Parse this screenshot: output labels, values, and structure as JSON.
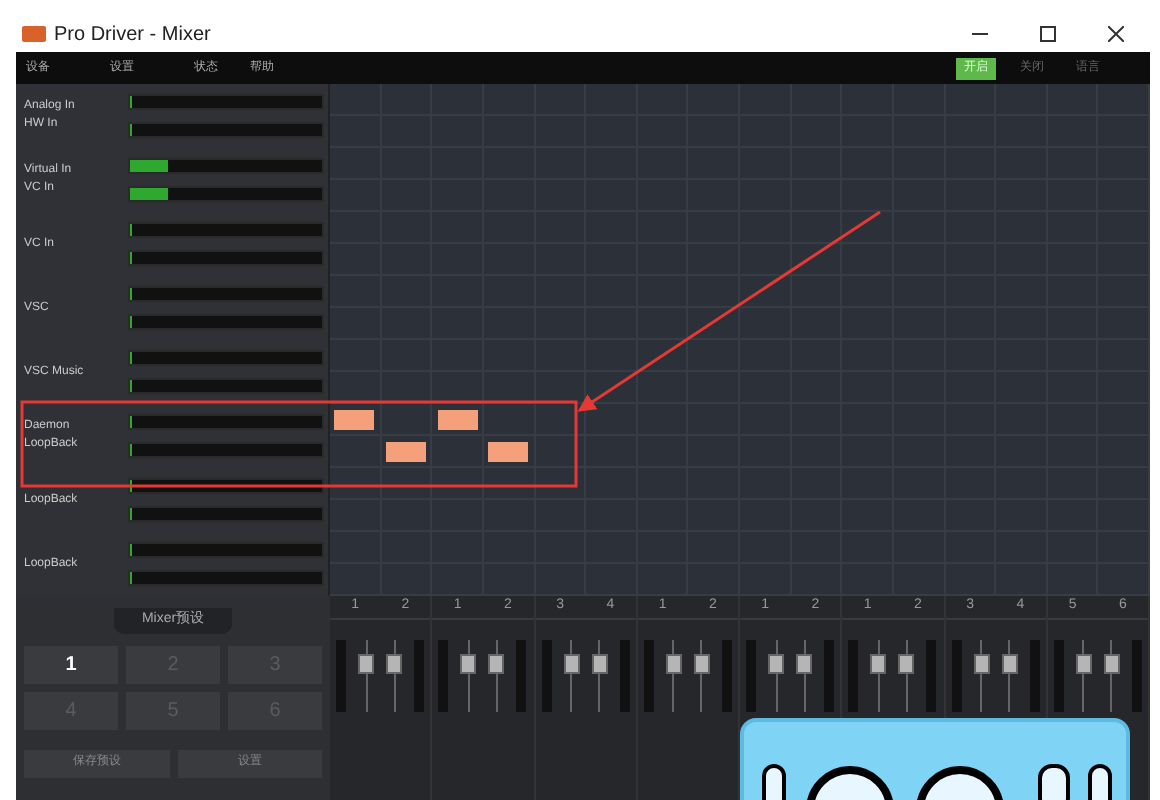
{
  "window": {
    "title": "Pro Driver - Mixer"
  },
  "menu": [
    "设备",
    "设置",
    "状态",
    "帮助"
  ],
  "toolbar": [
    {
      "label": "开启",
      "selected": true
    },
    {
      "label": "关闭",
      "selected": false
    },
    {
      "label": "语言",
      "selected": false
    }
  ],
  "channels": [
    {
      "label": [
        "Analog In",
        "HW In"
      ],
      "meters": [
        {
          "level": 0
        },
        {
          "level": 0
        }
      ]
    },
    {
      "label": [
        "Virtual In",
        "VC In"
      ],
      "meters": [
        {
          "level": 0.2
        },
        {
          "level": 0.2
        }
      ]
    },
    {
      "label": [
        "VC In"
      ],
      "meters": [
        {
          "level": 0
        },
        {
          "level": 0
        }
      ]
    },
    {
      "label": [
        "VSC"
      ],
      "meters": [
        {
          "level": 0
        },
        {
          "level": 0
        }
      ]
    },
    {
      "label": [
        "VSC Music"
      ],
      "meters": [
        {
          "level": 0
        },
        {
          "level": 0
        }
      ]
    },
    {
      "label": [
        "Daemon",
        "LoopBack"
      ],
      "meters": [
        {
          "level": 0
        },
        {
          "level": 0
        }
      ]
    },
    {
      "label": [
        "LoopBack"
      ],
      "meters": [
        {
          "level": 0
        },
        {
          "level": 0
        }
      ]
    },
    {
      "label": [
        "LoopBack"
      ],
      "meters": [
        {
          "level": 0
        },
        {
          "level": 0
        }
      ]
    }
  ],
  "grid": {
    "rows": [
      [
        false,
        false,
        false,
        false,
        false,
        false,
        false,
        false,
        false,
        false,
        false,
        false,
        false,
        false,
        false,
        false
      ],
      [
        false,
        false,
        false,
        false,
        false,
        false,
        false,
        false,
        false,
        false,
        false,
        false,
        false,
        false,
        false,
        false
      ],
      [
        false,
        false,
        false,
        false,
        false,
        false,
        false,
        false,
        false,
        false,
        false,
        false,
        false,
        false,
        false,
        false
      ],
      [
        false,
        false,
        false,
        false,
        false,
        false,
        false,
        false,
        false,
        false,
        false,
        false,
        false,
        false,
        false,
        false
      ],
      [
        false,
        false,
        false,
        false,
        false,
        false,
        false,
        false,
        false,
        false,
        false,
        false,
        false,
        false,
        false,
        false
      ],
      [
        false,
        false,
        false,
        false,
        false,
        false,
        false,
        false,
        false,
        false,
        false,
        false,
        false,
        false,
        false,
        false
      ],
      [
        false,
        false,
        false,
        false,
        false,
        false,
        false,
        false,
        false,
        false,
        false,
        false,
        false,
        false,
        false,
        false
      ],
      [
        false,
        false,
        false,
        false,
        false,
        false,
        false,
        false,
        false,
        false,
        false,
        false,
        false,
        false,
        false,
        false
      ],
      [
        false,
        false,
        false,
        false,
        false,
        false,
        false,
        false,
        false,
        false,
        false,
        false,
        false,
        false,
        false,
        false
      ],
      [
        false,
        false,
        false,
        false,
        false,
        false,
        false,
        false,
        false,
        false,
        false,
        false,
        false,
        false,
        false,
        false
      ],
      [
        true,
        false,
        true,
        false,
        false,
        false,
        false,
        false,
        false,
        false,
        false,
        false,
        false,
        false,
        false,
        false
      ],
      [
        false,
        true,
        false,
        true,
        false,
        false,
        false,
        false,
        false,
        false,
        false,
        false,
        false,
        false,
        false,
        false
      ],
      [
        false,
        false,
        false,
        false,
        false,
        false,
        false,
        false,
        false,
        false,
        false,
        false,
        false,
        false,
        false,
        false
      ],
      [
        false,
        false,
        false,
        false,
        false,
        false,
        false,
        false,
        false,
        false,
        false,
        false,
        false,
        false,
        false,
        false
      ],
      [
        false,
        false,
        false,
        false,
        false,
        false,
        false,
        false,
        false,
        false,
        false,
        false,
        false,
        false,
        false,
        false
      ],
      [
        false,
        false,
        false,
        false,
        false,
        false,
        false,
        false,
        false,
        false,
        false,
        false,
        false,
        false,
        false,
        false
      ]
    ]
  },
  "presets": {
    "title": "Mixer预设",
    "buttons": [
      {
        "label": "1",
        "selected": true
      },
      {
        "label": "2",
        "selected": false
      },
      {
        "label": "3",
        "selected": false
      },
      {
        "label": "4",
        "selected": false
      },
      {
        "label": "5",
        "selected": false
      },
      {
        "label": "6",
        "selected": false
      }
    ],
    "actions": [
      "保存预设",
      "设置"
    ]
  },
  "strips": [
    {
      "ports": [
        "1",
        "2"
      ],
      "faders": [
        {
          "level": 0.75
        },
        {
          "level": 0.75
        }
      ]
    },
    {
      "ports": [
        "1",
        "2"
      ],
      "faders": [
        {
          "level": 0.75
        },
        {
          "level": 0.75
        }
      ]
    },
    {
      "ports": [
        "3",
        "4"
      ],
      "faders": [
        {
          "level": 0.75
        },
        {
          "level": 0.75
        }
      ]
    },
    {
      "ports": [
        "1",
        "2"
      ],
      "faders": [
        {
          "level": 0.75
        },
        {
          "level": 0.75
        }
      ]
    },
    {
      "ports": [
        "1",
        "2"
      ],
      "faders": [
        {
          "level": 0.75
        },
        {
          "level": 0.75
        }
      ]
    },
    {
      "ports": [
        "1",
        "2"
      ],
      "faders": [
        {
          "level": 0.75
        },
        {
          "level": 0.75
        }
      ]
    },
    {
      "ports": [
        "3",
        "4"
      ],
      "faders": [
        {
          "level": 0.75
        },
        {
          "level": 0.75
        }
      ]
    },
    {
      "ports": [
        "5",
        "6"
      ],
      "faders": [
        {
          "level": 0.75
        },
        {
          "level": 0.75
        }
      ]
    }
  ]
}
